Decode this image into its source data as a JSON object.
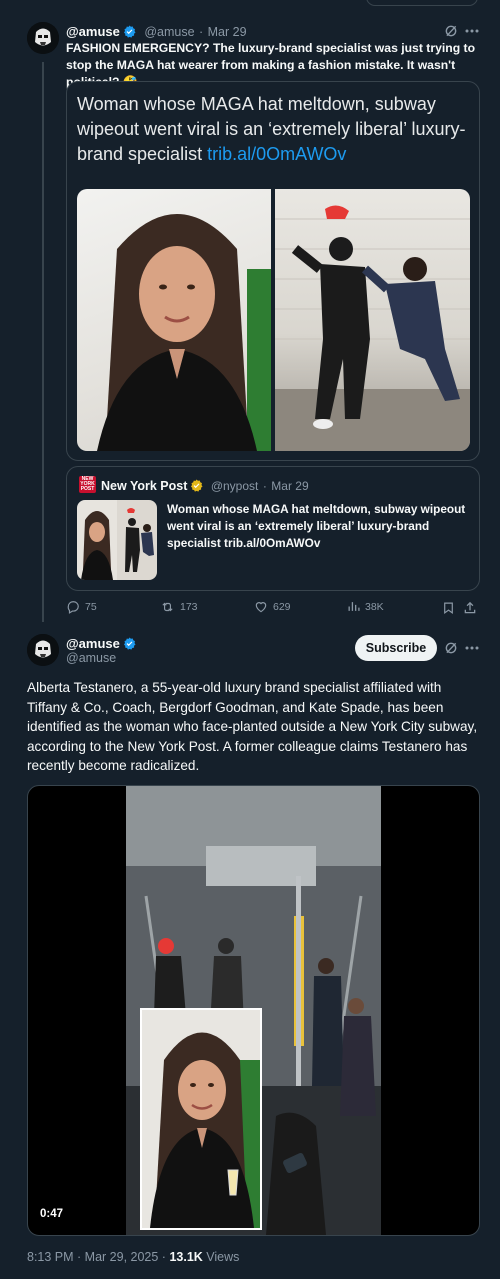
{
  "colors": {
    "background": "#15202b",
    "border": "#38444d",
    "muted": "#8b98a5",
    "link": "#1d9bf0",
    "verified": "#1d9bf0",
    "gold_verified": "#e2b719"
  },
  "tweet1": {
    "display_name": "@amuse",
    "handle": "@amuse",
    "dot": "·",
    "date": "Mar 29",
    "text": "FASHION EMERGENCY? The luxury-brand specialist was just trying to stop the MAGA hat wearer from making a fashion mistake. It wasn't political? 🤣",
    "card": {
      "headline": "Woman whose MAGA hat meltdown, subway wipeout went viral is an ‘extremely liberal’ luxury-brand specialist ",
      "link": "trib.al/0OmAWOv"
    },
    "quote": {
      "name": "New York Post",
      "handle": "@nypost",
      "dot": "·",
      "date": "Mar 29",
      "logo_text": "NEW YORK POST",
      "text": "Woman whose MAGA hat meltdown, subway wipeout went viral is an ‘extremely liberal’ luxury-brand specialist trib.al/0OmAWOv"
    },
    "stats": {
      "replies": "75",
      "reposts": "173",
      "likes": "629",
      "views": "38K"
    },
    "icons": {
      "grok": "grok-icon",
      "more": "more-icon",
      "reply": "reply-icon",
      "repost": "repost-icon",
      "like": "like-icon",
      "views": "views-icon",
      "bookmark": "bookmark-icon",
      "share": "share-icon"
    }
  },
  "tweet2": {
    "display_name": "@amuse",
    "handle": "@amuse",
    "subscribe_label": "Subscribe",
    "text": "Alberta Testanero, a 55-year-old luxury brand specialist affiliated with Tiffany & Co., Coach, Bergdorf Goodman, and Kate Spade, has been identified as the woman who face-planted outside a New York City subway, according to the New York Post. A former colleague claims Testanero has recently become radicalized.",
    "video_duration": "0:47",
    "timestamp": "8:13 PM · Mar 29, 2025 · ",
    "views_count": "13.1K",
    "views_label": " Views"
  }
}
